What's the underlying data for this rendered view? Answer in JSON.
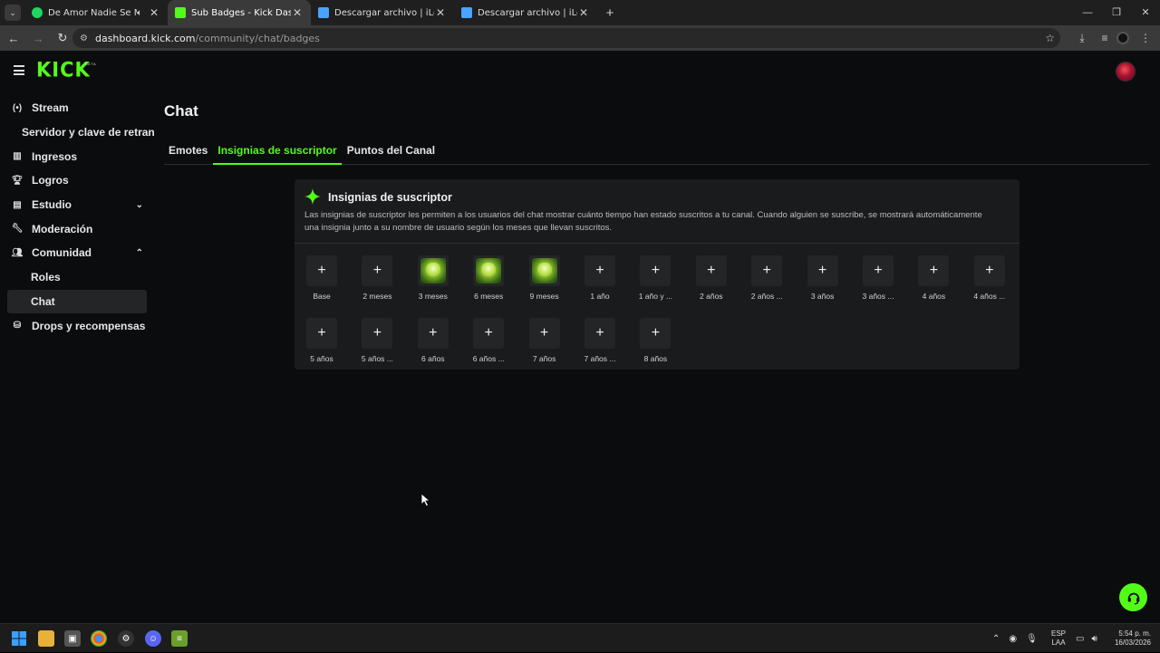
{
  "browser": {
    "tabs": [
      {
        "title": "De Amor Nadie Se Muere -",
        "favicon_color": "#1ed760",
        "audio": true,
        "active": false
      },
      {
        "title": "Sub Badges - Kick Dashboard",
        "favicon_color": "#53fc18",
        "audio": false,
        "active": true
      },
      {
        "title": "Descargar archivo | iLoveIMG",
        "favicon_color": "#4aa3ff",
        "audio": false,
        "active": false
      },
      {
        "title": "Descargar archivo | iLoveIMG",
        "favicon_color": "#4aa3ff",
        "audio": false,
        "active": false
      }
    ],
    "address": {
      "host": "dashboard.kick.com",
      "path": "/community/chat/badges"
    }
  },
  "brand": {
    "logo": "KICK",
    "beta": "BETA",
    "accent": "#53fc18"
  },
  "sidebar": {
    "items": [
      {
        "label": "Stream",
        "icon": "broadcast-icon"
      },
      {
        "label": "Servidor y clave de retransmisión",
        "sub": true
      },
      {
        "label": "Ingresos",
        "icon": "chart-icon"
      },
      {
        "label": "Logros",
        "icon": "trophy-icon"
      },
      {
        "label": "Estudio",
        "icon": "studio-icon",
        "chevron": "down"
      },
      {
        "label": "Moderación",
        "icon": "wrench-icon"
      },
      {
        "label": "Comunidad",
        "icon": "community-icon",
        "chevron": "up"
      },
      {
        "label": "Roles",
        "sub": true
      },
      {
        "label": "Chat",
        "sub": true,
        "selected": true
      },
      {
        "label": "Drops y recompensas",
        "icon": "drops-icon"
      }
    ]
  },
  "main": {
    "title": "Chat",
    "tabs": [
      {
        "label": "Emotes",
        "active": false
      },
      {
        "label": "Insignias de suscriptor",
        "active": true
      },
      {
        "label": "Puntos del Canal",
        "active": false
      }
    ]
  },
  "card": {
    "title": "Insignias de suscriptor",
    "description": "Las insignias de suscriptor les permiten a los usuarios del chat mostrar cuánto tiempo han estado suscritos a tu canal. Cuando alguien se suscribe, se mostrará automáticamente una insignia junto a su nombre de usuario según los meses que llevan suscritos.",
    "badges": [
      {
        "label": "Base",
        "image": false
      },
      {
        "label": "2 meses",
        "image": false
      },
      {
        "label": "3 meses",
        "image": true
      },
      {
        "label": "6 meses",
        "image": true
      },
      {
        "label": "9 meses",
        "image": true
      },
      {
        "label": "1 año",
        "image": false
      },
      {
        "label": "1 año y ...",
        "image": false
      },
      {
        "label": "2 años",
        "image": false
      },
      {
        "label": "2 años ...",
        "image": false
      },
      {
        "label": "3 años",
        "image": false
      },
      {
        "label": "3 años ...",
        "image": false
      },
      {
        "label": "4 años",
        "image": false
      },
      {
        "label": "4 años ...",
        "image": false
      },
      {
        "label": "5 años",
        "image": false
      },
      {
        "label": "5 años ...",
        "image": false
      },
      {
        "label": "6 años",
        "image": false
      },
      {
        "label": "6 años ...",
        "image": false
      },
      {
        "label": "7 años",
        "image": false
      },
      {
        "label": "7 años ...",
        "image": false
      },
      {
        "label": "8 años",
        "image": false
      }
    ]
  },
  "taskbar": {
    "lang": [
      "ESP",
      "LAA"
    ],
    "time": "5:54 p. m.",
    "date": "16/03/2026"
  }
}
